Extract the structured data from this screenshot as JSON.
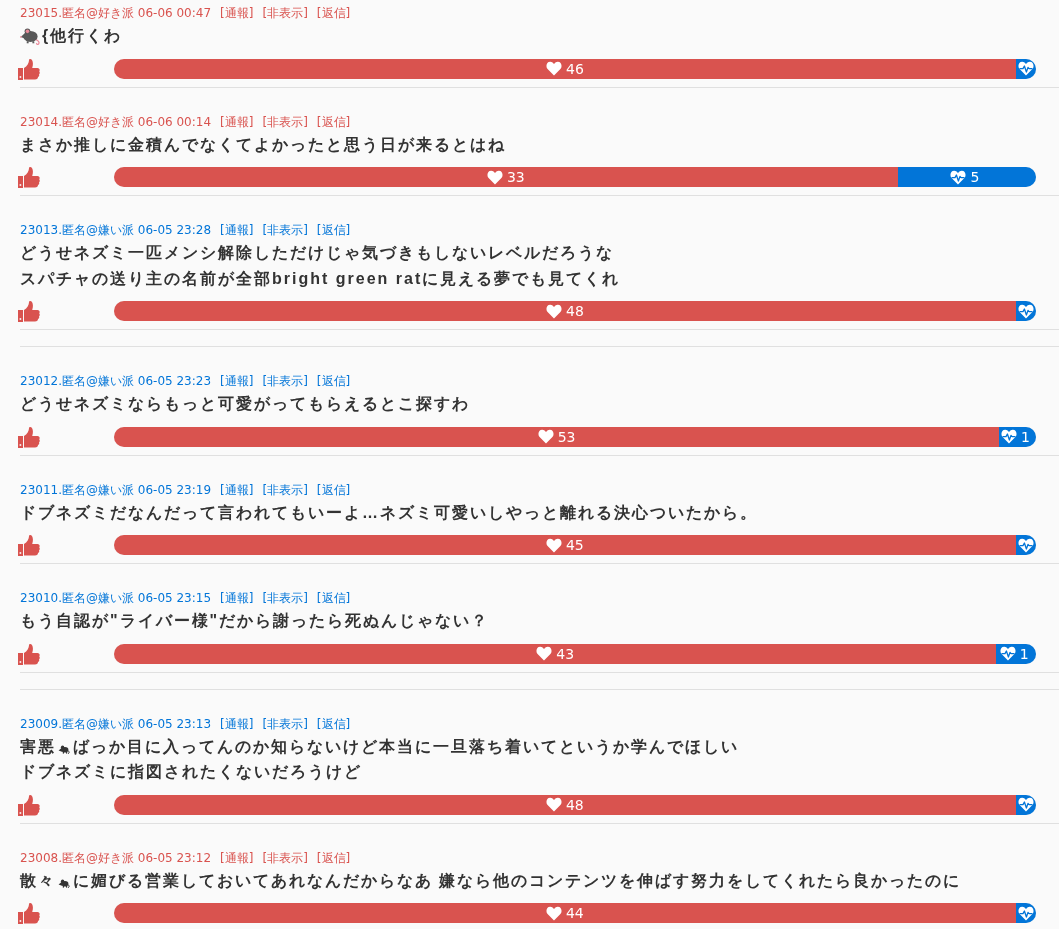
{
  "posts": [
    {
      "kind": "post",
      "color": "#d9534f",
      "header": "23015.匿名@好き派 06-06 00:47",
      "actions": [
        "[通報]",
        "[非表示]",
        "[返信]"
      ],
      "lines": [
        [
          {
            "kind": "sticker"
          },
          {
            "kind": "text",
            "text": "{他行くわ"
          }
        ]
      ],
      "likes": "46",
      "level": 0.979
    },
    {
      "kind": "post",
      "color": "#d9534f",
      "header": "23014.匿名@好き派 06-06 00:14",
      "actions": [
        "[通報]",
        "[非表示]",
        "[返信]"
      ],
      "lines": [
        [
          {
            "kind": "text",
            "text": "まさか推しに金積んでなくてよかったと思う日が来るとはね"
          }
        ]
      ],
      "likes": "33",
      "dislikes": "5",
      "level": 0.85
    },
    {
      "kind": "post",
      "color": "#0275d8",
      "header": "23013.匿名@嫌い派 06-05 23:28",
      "actions": [
        "[通報]",
        "[非表示]",
        "[返信]"
      ],
      "lines": [
        [
          {
            "kind": "text",
            "text": "どうせネズミ一匹メンシ解除しただけじゃ気づきもしないレベルだろうな"
          }
        ],
        [
          {
            "kind": "text",
            "text": "スパチャの送り主の名前が全部bright green ratに見える夢でも見てくれ"
          }
        ]
      ],
      "likes": "48",
      "level": 0.98
    },
    {
      "kind": "divider"
    },
    {
      "kind": "post",
      "color": "#0275d8",
      "header": "23012.匿名@嫌い派 06-05 23:23",
      "actions": [
        "[通報]",
        "[非表示]",
        "[返信]"
      ],
      "lines": [
        [
          {
            "kind": "text",
            "text": "どうせネズミならもっと可愛がってもらえるとこ探すわ"
          }
        ]
      ],
      "likes": "53",
      "dislikes": "1",
      "level": 0.964
    },
    {
      "kind": "post",
      "color": "#0275d8",
      "header": "23011.匿名@嫌い派 06-05 23:19",
      "actions": [
        "[通報]",
        "[非表示]",
        "[返信]"
      ],
      "lines": [
        [
          {
            "kind": "text",
            "text": "ドブネズミだなんだって言われてもいーよ…ネズミ可愛いしやっと離れる決心ついたから。"
          }
        ]
      ],
      "likes": "45",
      "level": 0.978
    },
    {
      "kind": "post",
      "color": "#0275d8",
      "header": "23010.匿名@嫌い派 06-05 23:15",
      "actions": [
        "[通報]",
        "[非表示]",
        "[返信]"
      ],
      "lines": [
        [
          {
            "kind": "text",
            "text": "もう自認が\"ライバー様\"だから謝ったら死ぬんじゃない？"
          }
        ]
      ],
      "likes": "43",
      "dislikes": "1",
      "level": 0.957
    },
    {
      "kind": "divider"
    },
    {
      "kind": "post",
      "color": "#0275d8",
      "header": "23009.匿名@嫌い派 06-05 23:13",
      "actions": [
        "[通報]",
        "[非表示]",
        "[返信]"
      ],
      "lines": [
        [
          {
            "kind": "text",
            "text": "害悪"
          },
          {
            "kind": "emoji"
          },
          {
            "kind": "text",
            "text": "ばっか目に入ってんのか知らないけど本当に一旦落ち着いてというか学んでほしい"
          }
        ],
        [
          {
            "kind": "text",
            "text": "ドブネズミに指図されたくないだろうけど"
          }
        ]
      ],
      "likes": "48",
      "level": 0.978
    },
    {
      "kind": "post",
      "color": "#d9534f",
      "header": "23008.匿名@好き派 06-05 23:12",
      "actions": [
        "[通報]",
        "[非表示]",
        "[返信]"
      ],
      "lines": [
        [
          {
            "kind": "text",
            "text": "散々"
          },
          {
            "kind": "emoji"
          },
          {
            "kind": "text",
            "text": "に媚びる営業しておいてあれなんだからなあ 嫌なら他のコンテンツを伸ばす努力をしてくれたら良かったのに"
          }
        ]
      ],
      "likes": "44",
      "level": 0.978
    }
  ]
}
